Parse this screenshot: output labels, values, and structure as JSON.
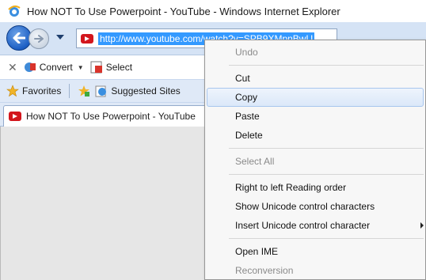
{
  "window": {
    "title": "How NOT To Use Powerpoint - YouTube - Windows Internet Explorer"
  },
  "address_bar": {
    "url": "http://www.youtube.com/watch?v=SPB9XMpnBwU"
  },
  "command_bar": {
    "convert_label": "Convert",
    "select_label": "Select"
  },
  "favorites_bar": {
    "favorites_label": "Favorites",
    "suggested_label": "Suggested Sites"
  },
  "tab": {
    "title": "How NOT To Use Powerpoint - YouTube"
  },
  "context_menu": {
    "undo": "Undo",
    "cut": "Cut",
    "copy": "Copy",
    "paste": "Paste",
    "delete": "Delete",
    "select_all": "Select All",
    "rtl_reading": "Right to left Reading order",
    "show_unicode": "Show Unicode control characters",
    "insert_unicode": "Insert Unicode control character",
    "open_ime": "Open IME",
    "reconversion": "Reconversion"
  },
  "colors": {
    "selection": "#3399ff",
    "youtube_red": "#d3161d",
    "ie_blue": "#1d5fc4"
  },
  "icons": [
    "ie-logo-icon",
    "back-arrow-icon",
    "forward-arrow-icon",
    "chevron-down-icon",
    "youtube-favicon-icon",
    "close-icon",
    "convert-icon",
    "select-icon",
    "favorites-star-icon",
    "add-favorites-icon",
    "suggested-sites-icon",
    "submenu-arrow-icon"
  ]
}
